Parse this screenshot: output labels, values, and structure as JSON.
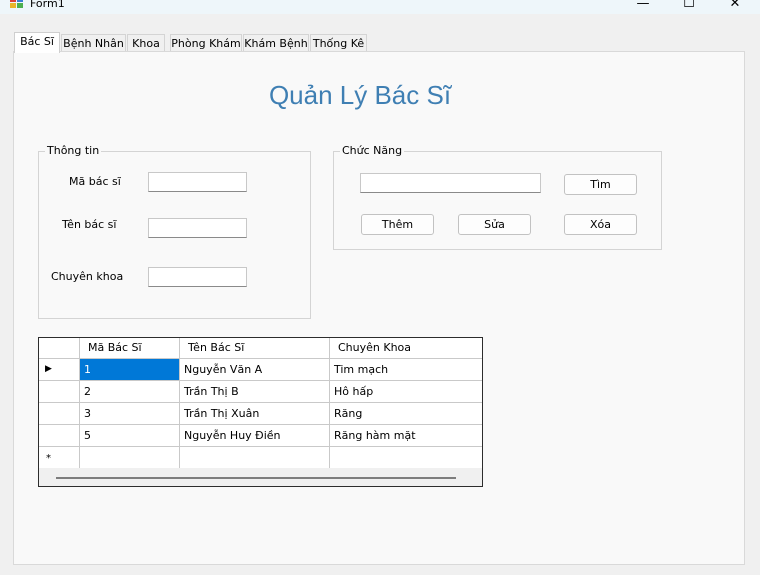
{
  "window": {
    "title": "Form1",
    "minimize_glyph": "—",
    "maximize_glyph": "☐",
    "close_glyph": "✕"
  },
  "tabs": [
    "Bác Sĩ",
    "Bệnh Nhân",
    "Khoa",
    "Phòng Khám",
    "Khám Bệnh",
    "Thống Kê"
  ],
  "page_title": "Quản Lý Bác Sĩ",
  "info_group": {
    "legend": "Thông tin",
    "ma_label": "Mã bác sĩ",
    "ten_label": "Tên bác sĩ",
    "chuyenkhoa_label": "Chuyên khoa",
    "ma_value": "",
    "ten_value": "",
    "chuyenkhoa_value": ""
  },
  "func_group": {
    "legend": "Chức Năng",
    "search_value": "",
    "search_button": "Tìm",
    "add_button": "Thêm",
    "edit_button": "Sửa",
    "delete_button": "Xóa"
  },
  "grid": {
    "columns": [
      "Mã Bác Sĩ",
      "Tên Bác Sĩ",
      "Chuyên Khoa"
    ],
    "rows": [
      [
        "1",
        "Nguyễn Văn A",
        "Tim mạch"
      ],
      [
        "2",
        "Trần Thị B",
        "Hô hấp"
      ],
      [
        "3",
        "Trần Thị Xuân",
        "Răng"
      ],
      [
        "5",
        "Nguyễn Huy Điền",
        "Răng hàm mặt"
      ]
    ],
    "current_row_glyph": "▶",
    "new_row_glyph": "*"
  },
  "colors": {
    "title_blue": "#3f7fb3",
    "selection_blue": "#0078d7"
  }
}
